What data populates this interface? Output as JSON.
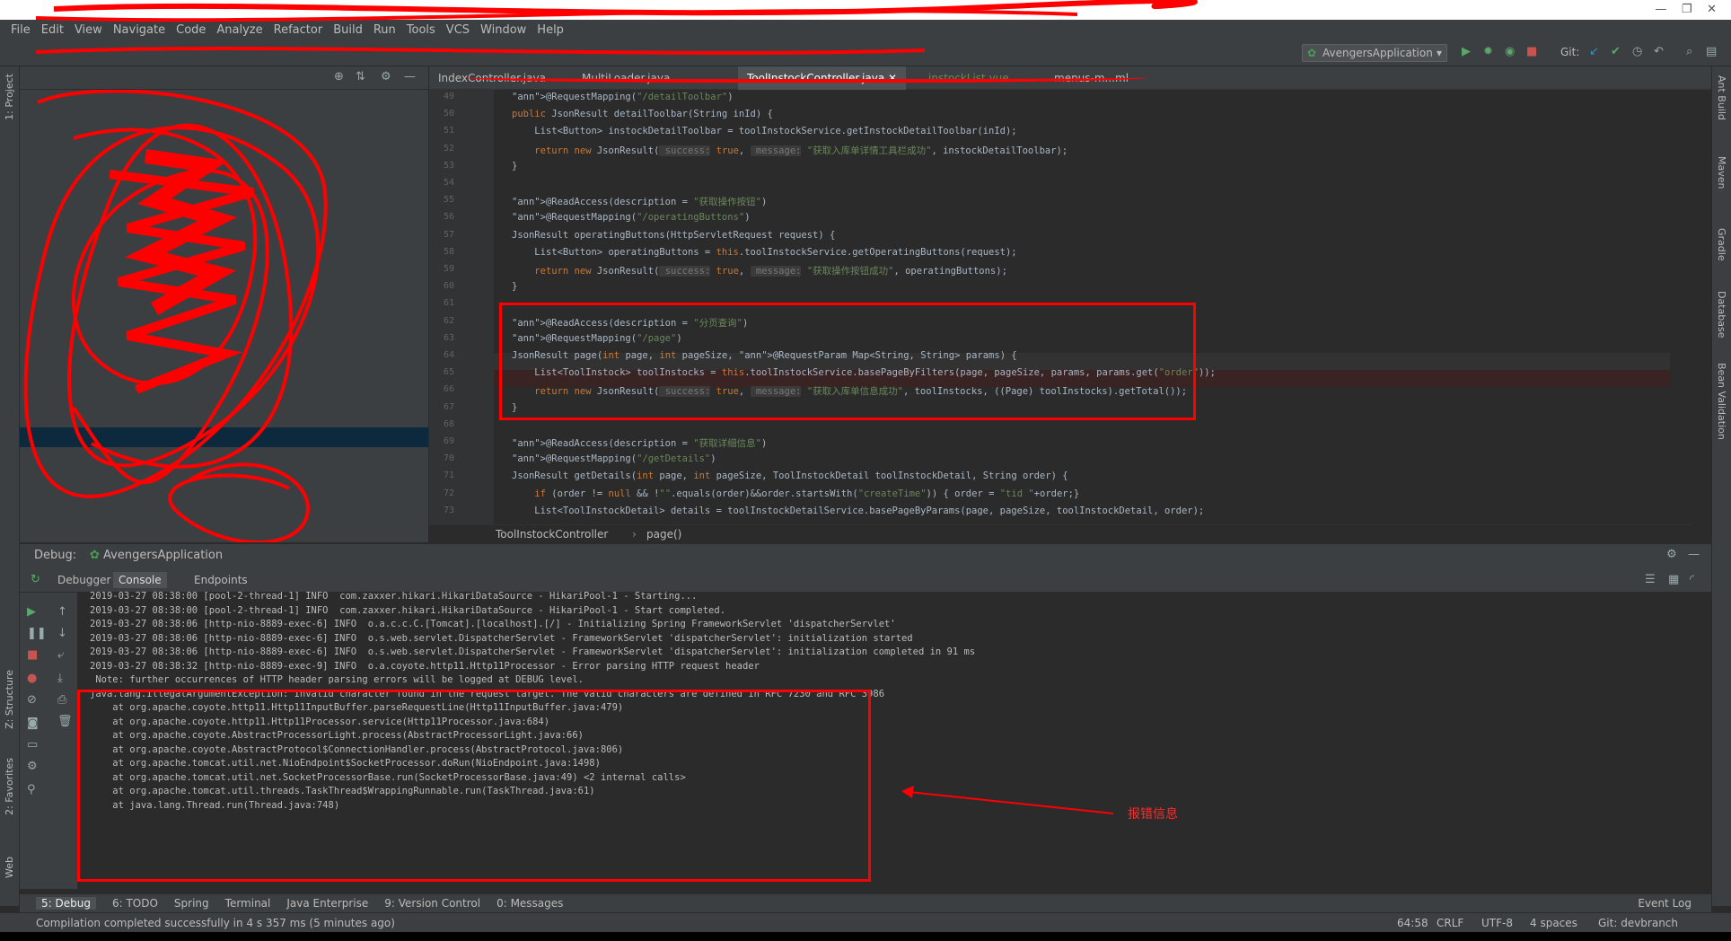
{
  "menu": [
    "File",
    "Edit",
    "View",
    "Navigate",
    "Code",
    "Analyze",
    "Refactor",
    "Build",
    "Run",
    "Tools",
    "VCS",
    "Window",
    "Help"
  ],
  "toolbar": {
    "run_config": "AvengersApplication",
    "git_label": "Git:"
  },
  "tabs": [
    {
      "label": "IndexController.java"
    },
    {
      "label": "MultiLoader.java"
    },
    {
      "label": "ToolInstockController.java",
      "active": true
    },
    {
      "label": "instockList.vue"
    },
    {
      "label": "menus-m...ml"
    }
  ],
  "editor": {
    "lines": [
      {
        "n": "49",
        "t": "@RequestMapping(\"/detailToolbar\")"
      },
      {
        "n": "50",
        "t": "public JsonResult detailToolbar(String inId) {"
      },
      {
        "n": "51",
        "t": "    List<Button> instockDetailToolbar = toolInstockService.getInstockDetailToolbar(inId);"
      },
      {
        "n": "52",
        "t": "    return new JsonResult( success: true,  message: \"获取入库单详情工具栏成功\", instockDetailToolbar);"
      },
      {
        "n": "53",
        "t": "}"
      },
      {
        "n": "54",
        "t": ""
      },
      {
        "n": "55",
        "t": "@ReadAccess(description = \"获取操作按钮\")"
      },
      {
        "n": "56",
        "t": "@RequestMapping(\"/operatingButtons\")"
      },
      {
        "n": "57",
        "t": "JsonResult operatingButtons(HttpServletRequest request) {"
      },
      {
        "n": "58",
        "t": "    List<Button> operatingButtons = this.toolInstockService.getOperatingButtons(request);"
      },
      {
        "n": "59",
        "t": "    return new JsonResult( success: true,  message: \"获取操作按钮成功\", operatingButtons);"
      },
      {
        "n": "60",
        "t": "}"
      },
      {
        "n": "61",
        "t": ""
      },
      {
        "n": "62",
        "t": "@ReadAccess(description = \"分页查询\")"
      },
      {
        "n": "63",
        "t": "@RequestMapping(\"/page\")"
      },
      {
        "n": "64",
        "t": "JsonResult page(int page, int pageSize, @RequestParam Map<String, String> params) {"
      },
      {
        "n": "65",
        "t": "    List<ToolInstock> toolInstocks = this.toolInstockService.basePageByFilters(page, pageSize, params, params.get(\"order\"));"
      },
      {
        "n": "66",
        "t": "    return new JsonResult( success: true,  message: \"获取入库单信息成功\", toolInstocks, ((Page) toolInstocks).getTotal());"
      },
      {
        "n": "67",
        "t": "}"
      },
      {
        "n": "68",
        "t": ""
      },
      {
        "n": "69",
        "t": "@ReadAccess(description = \"获取详细信息\")"
      },
      {
        "n": "70",
        "t": "@RequestMapping(\"/getDetails\")"
      },
      {
        "n": "71",
        "t": "JsonResult getDetails(int page, int pageSize, ToolInstockDetail toolInstockDetail, String order) {"
      },
      {
        "n": "72",
        "t": "    if (order != null && !\"\".equals(order)&&order.startsWith(\"createTime\")) { order = \"tid \"+order;}"
      },
      {
        "n": "73",
        "t": "    List<ToolInstockDetail> details = toolInstockDetailService.basePageByParams(page, pageSize, toolInstockDetail, order);"
      }
    ]
  },
  "breadcrumb": {
    "class": "ToolInstockController",
    "method": "page()"
  },
  "debug": {
    "title": "Debug:",
    "config": "AvengersApplication",
    "tabs": [
      "Debugger",
      "Console",
      "Endpoints"
    ]
  },
  "console": [
    "2019-03-27 08:38:00 [pool-2-thread-1] INFO  com.zaxxer.hikari.HikariDataSource - HikariPool-1 - Starting...",
    "2019-03-27 08:38:00 [pool-2-thread-1] INFO  com.zaxxer.hikari.HikariDataSource - HikariPool-1 - Start completed.",
    "2019-03-27 08:38:06 [http-nio-8889-exec-6] INFO  o.a.c.c.C.[Tomcat].[localhost].[/] - Initializing Spring FrameworkServlet 'dispatcherServlet'",
    "2019-03-27 08:38:06 [http-nio-8889-exec-6] INFO  o.s.web.servlet.DispatcherServlet - FrameworkServlet 'dispatcherServlet': initialization started",
    "2019-03-27 08:38:06 [http-nio-8889-exec-6] INFO  o.s.web.servlet.DispatcherServlet - FrameworkServlet 'dispatcherServlet': initialization completed in 91 ms",
    "2019-03-27 08:38:32 [http-nio-8889-exec-9] INFO  o.a.coyote.http11.Http11Processor - Error parsing HTTP request header",
    " Note: further occurrences of HTTP header parsing errors will be logged at DEBUG level.",
    "java.lang.IllegalArgumentException: Invalid character found in the request target. The valid characters are defined in RFC 7230 and RFC 3986",
    "    at org.apache.coyote.http11.Http11InputBuffer.parseRequestLine(Http11InputBuffer.java:479)",
    "    at org.apache.coyote.http11.Http11Processor.service(Http11Processor.java:684)",
    "    at org.apache.coyote.AbstractProcessorLight.process(AbstractProcessorLight.java:66)",
    "    at org.apache.coyote.AbstractProtocol$ConnectionHandler.process(AbstractProtocol.java:806)",
    "    at org.apache.tomcat.util.net.NioEndpoint$SocketProcessor.doRun(NioEndpoint.java:1498)",
    "    at org.apache.tomcat.util.net.SocketProcessorBase.run(SocketProcessorBase.java:49) <2 internal calls>",
    "    at org.apache.tomcat.util.threads.TaskThread$WrappingRunnable.run(TaskThread.java:61)",
    "    at java.lang.Thread.run(Thread.java:748)"
  ],
  "annotation_label": "报错信息",
  "bottom_tabs": [
    "5: Debug",
    "6: TODO",
    "Spring",
    "Terminal",
    "Java Enterprise",
    "9: Version Control",
    "0: Messages"
  ],
  "event_log": "Event Log",
  "status": {
    "message": "Compilation completed successfully in 4 s 357 ms (5 minutes ago)",
    "position": "64:58",
    "line_sep": "CRLF",
    "encoding": "UTF-8",
    "indent": "4 spaces",
    "branch": "Git: devbranch"
  },
  "right_tools": [
    "Ant Build",
    "Maven",
    "Gradle",
    "Database",
    "Bean Validation"
  ],
  "left_tools": [
    "1: Project",
    "Z: Structure",
    "2: Favorites",
    "Web"
  ],
  "colors": {
    "accent": "#ff0000",
    "bg": "#2b2b2b",
    "panel": "#3c3f41"
  }
}
